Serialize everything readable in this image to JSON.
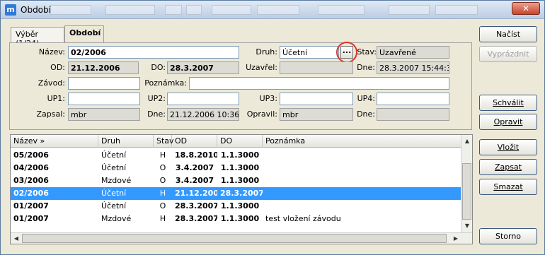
{
  "window": {
    "title": "Období",
    "close_glyph": "✕",
    "icon_letter": "m"
  },
  "tabs": [
    {
      "label": "Výběr (1/24)"
    },
    {
      "label": "Období"
    }
  ],
  "form": {
    "nazev": {
      "label": "Název:",
      "value": "02/2006"
    },
    "druh": {
      "label": "Druh:",
      "value": "Účetní",
      "button": "..."
    },
    "stav": {
      "label": "Stav:",
      "value": "Uzavřené"
    },
    "od": {
      "label": "OD:",
      "value": "21.12.2006"
    },
    "do": {
      "label": "DO:",
      "value": "28.3.2007"
    },
    "uzavrel": {
      "label": "Uzavřel:",
      "value": ""
    },
    "dne1": {
      "label": "Dne:",
      "value": "28.3.2007 15:44:31"
    },
    "zavod": {
      "label": "Závod:",
      "value": ""
    },
    "poznamka": {
      "label": "Poznámka:",
      "value": ""
    },
    "up1": {
      "label": "UP1:",
      "value": ""
    },
    "up2": {
      "label": "UP2:",
      "value": ""
    },
    "up3": {
      "label": "UP3:",
      "value": ""
    },
    "up4": {
      "label": "UP4:",
      "value": ""
    },
    "zapsal": {
      "label": "Zapsal:",
      "value": "mbr"
    },
    "dne2": {
      "label": "Dne:",
      "value": "21.12.2006 10:36:00"
    },
    "opravil": {
      "label": "Opravil:",
      "value": "mbr"
    },
    "dne3": {
      "label": "Dne:",
      "value": ""
    }
  },
  "grid": {
    "columns": [
      "Název »",
      "Druh",
      "Stav",
      "OD",
      "DO",
      "Poznámka"
    ],
    "rows": [
      {
        "nazev": "05/2006",
        "druh": "Účetní",
        "stav": "H",
        "od": "18.8.2010",
        "do": "1.1.3000",
        "poznamka": ""
      },
      {
        "nazev": "04/2006",
        "druh": "Účetní",
        "stav": "O",
        "od": "3.4.2007",
        "do": "1.1.3000",
        "poznamka": ""
      },
      {
        "nazev": "03/2006",
        "druh": "Mzdové",
        "stav": "O",
        "od": "3.4.2007",
        "do": "1.1.3000",
        "poznamka": ""
      },
      {
        "nazev": "02/2006",
        "druh": "Účetní",
        "stav": "H",
        "od": "21.12.2006",
        "do": "28.3.2007",
        "poznamka": ""
      },
      {
        "nazev": "01/2007",
        "druh": "Účetní",
        "stav": "O",
        "od": "28.3.2007",
        "do": "1.1.3000",
        "poznamka": ""
      },
      {
        "nazev": "01/2007",
        "druh": "Mzdové",
        "stav": "H",
        "od": "28.3.2007",
        "do": "1.1.3000",
        "poznamka": "test vložení závodu"
      }
    ]
  },
  "buttons": {
    "nacist": "Načíst seznam",
    "vyprazdnit": "Vyprázdnit",
    "schvalit": "Schválit",
    "opravit": "Opravit",
    "vlozit": "Vložit",
    "zapsat": "Zapsat",
    "smazat": "Smazat",
    "storno": "Storno"
  },
  "scroll_glyphs": {
    "up": "▲",
    "down": "▼",
    "left": "◀",
    "right": "▶"
  }
}
